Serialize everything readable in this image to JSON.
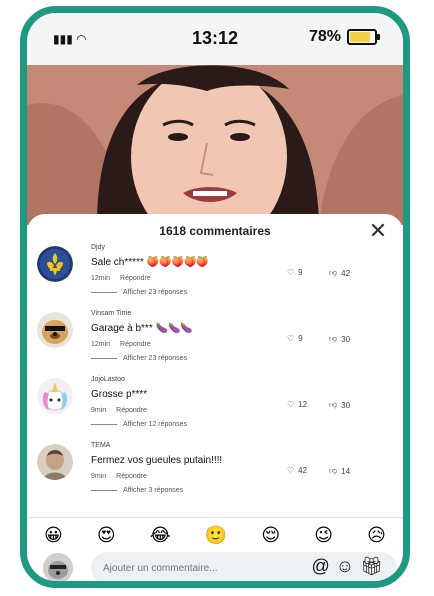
{
  "status": {
    "time": "13:12",
    "battery": "78%",
    "battery_level": 0.78
  },
  "comments_sheet": {
    "title": "1618 commentaires",
    "close_icon": "close-icon",
    "comments": [
      {
        "user": "Djdy",
        "text": "Sale ch***** 🍑🍑🍑🍑🍑",
        "time": "12min",
        "reply": "Répondre",
        "replies": "Afficher 23 réponses",
        "likes": "9",
        "dislikes": "42"
      },
      {
        "user": "Vinsam Time",
        "text": "Garage à b*** 🍆🍆🍆",
        "time": "12min",
        "reply": "Répondre",
        "replies": "Afficher 23 réponses",
        "likes": "9",
        "dislikes": "30"
      },
      {
        "user": "JojoLastoo",
        "text": "Grosse p****",
        "time": "9min",
        "reply": "Répondre",
        "replies": "Afficher 12 réponses",
        "likes": "12",
        "dislikes": "30"
      },
      {
        "user": "TEMA",
        "text": "Fermez vos gueules putain!!!!",
        "time": "9min",
        "reply": "Répondre",
        "replies": "Afficher 3 réponses",
        "likes": "42",
        "dislikes": "14"
      }
    ]
  },
  "emoji_bar": [
    "😀",
    "😍",
    "😂",
    "🙂",
    "😌",
    "😉",
    "😥"
  ],
  "composer": {
    "placeholder": "Ajouter un commentaire...",
    "icons": [
      "at-icon",
      "emoji-icon",
      "gift-icon"
    ]
  },
  "colors": {
    "frame": "#1f9a82",
    "battery": "#f2d14a",
    "video_bg": "#c58978"
  }
}
